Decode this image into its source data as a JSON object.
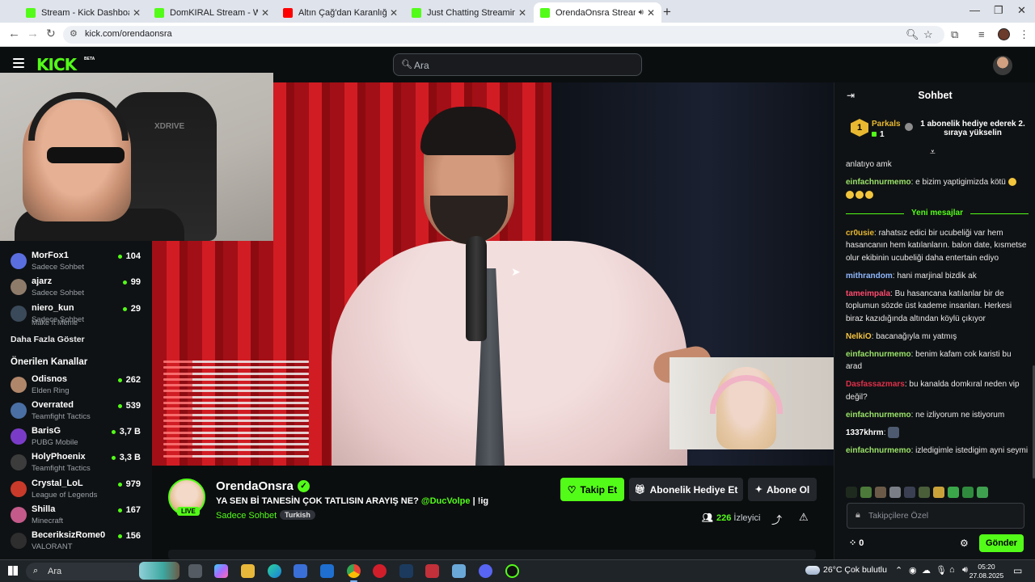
{
  "browser": {
    "tabs": [
      {
        "title": "Stream - Kick Dashboard",
        "color": "#53fc18"
      },
      {
        "title": "DomKIRAL Stream - Watch Live",
        "color": "#53fc18"
      },
      {
        "title": "Altın Çağ'dan Karanlığa: Yuga D",
        "color": "#ff0000"
      },
      {
        "title": "Just Chatting Streaming - Live S",
        "color": "#53fc18"
      },
      {
        "title": "OrendaOnsra Stream - Watc",
        "color": "#53fc18"
      }
    ],
    "url": "kick.com/orendaonsra"
  },
  "header": {
    "logo": "KICK",
    "logo_badge": "BETA",
    "search_placeholder": "Ara"
  },
  "sidebar": {
    "cut_item_category": "Make It Meme",
    "following": [
      {
        "name": "MorFox1",
        "category": "Sadece Sohbet",
        "viewers": "104",
        "color": "#5b6ee0"
      },
      {
        "name": "ajarz",
        "category": "Sadece Sohbet",
        "viewers": "99",
        "color": "#8e7b6a"
      },
      {
        "name": "niero_kun",
        "category": "Sadece Sohbet",
        "viewers": "29",
        "color": "#3a4a5a"
      }
    ],
    "show_more": "Daha Fazla Göster",
    "recommended_title": "Önerilen Kanallar",
    "recommended": [
      {
        "name": "Odisnos",
        "category": "Elden Ring",
        "viewers": "262",
        "color": "#b0866a"
      },
      {
        "name": "Overrated",
        "category": "Teamfight Tactics",
        "viewers": "539",
        "color": "#4a6fa5"
      },
      {
        "name": "BarisG",
        "category": "PUBG Mobile",
        "viewers": "3,7 B",
        "color": "#7a3cc8"
      },
      {
        "name": "HolyPhoenix",
        "category": "Teamfight Tactics",
        "viewers": "3,3 B",
        "color": "#3c3c3c"
      },
      {
        "name": "Crystal_LoL",
        "category": "League of Legends",
        "viewers": "979",
        "color": "#c93a2a"
      },
      {
        "name": "Shilla",
        "category": "Minecraft",
        "viewers": "167",
        "color": "#c45a8a"
      },
      {
        "name": "BeceriksizRome0",
        "category": "VALORANT",
        "viewers": "156",
        "color": "#2e2e2e"
      }
    ]
  },
  "webcam": {
    "chair_brand": "XDRIVE"
  },
  "stream": {
    "streamer": "OrendaOnsra",
    "live_badge": "LIVE",
    "verified_glyph": "✓",
    "title_prefix": "YA SEN Bİ TANESİN ÇOK TATLISIN ARAYIŞ NE?",
    "title_mention": "@DucVolpe",
    "title_suffix": "| !ig",
    "category": "Sadece Sohbet",
    "tag": "Turkish",
    "follow_label": "Takip Et",
    "gift_label": "Abonelik Hediye Et",
    "subscribe_label": "Abone Ol",
    "viewers": "226",
    "viewers_label": "İzleyici"
  },
  "chat": {
    "title": "Sohbet",
    "pinned": {
      "rank": "1",
      "user": "Parkals",
      "count": "1",
      "text": "1 abonelik hediye ederek 2. sıraya yükselin"
    },
    "messages_before": [
      {
        "user": "",
        "color": "#ffffff",
        "text": "anlatıyo amk"
      },
      {
        "user": "einfachnurmemo",
        "color": "#9be36a",
        "text": "e bizim yaptigimizda kötü"
      }
    ],
    "new_messages_label": "Yeni mesajlar",
    "messages_after": [
      {
        "user": "cr0usie",
        "color": "#e8b830",
        "text": "rahatsız edici bir ucubeliği var hem hasancanın hem katılanların. balon date, kısmetse olur ekibinin ucubeliği daha entertain ediyo"
      },
      {
        "user": "mithrandom",
        "color": "#8fb8ff",
        "text": "hani marjinal bizdik ak"
      },
      {
        "user": "tameimpala",
        "color": "#ff4a6e",
        "text": "Bu hasancana katılanlar bir de toplumun sözde üst kademe insanları. Herkesi biraz kazıdığında altından köylü çıkıyor"
      },
      {
        "user": "NelkiO",
        "color": "#f5c542",
        "text": "bacanağıyla mı yatmış"
      },
      {
        "user": "einfachnurmemo",
        "color": "#9be36a",
        "text": "benim kafam cok karisti bu arad"
      },
      {
        "user": "Dasfassazmars",
        "color": "#e0304a",
        "text": "bu kanalda domkıral neden vip değil?"
      },
      {
        "user": "einfachnurmemo",
        "color": "#9be36a",
        "text": "ne izliyorum ne istiyorum"
      },
      {
        "user": "1337khrm",
        "color": "#ffffff",
        "text": ""
      },
      {
        "user": "einfachnurmemo",
        "color": "#9be36a",
        "text": "izledigimle istedigim ayni seymi"
      }
    ],
    "input_placeholder": "Takipçilere Özel",
    "points": "0",
    "send_label": "Gönder"
  },
  "taskbar": {
    "search_text": "Ara",
    "weather": "26°C  Çok bulutlu",
    "time": "05:20",
    "date": "27.08.2025"
  },
  "colors": {
    "brand": "#53fc18",
    "bg": "#0b0e0f",
    "panel": "#0f1214"
  }
}
